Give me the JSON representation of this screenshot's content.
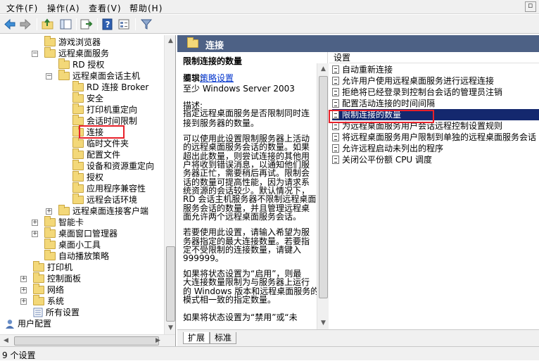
{
  "menu": {
    "file": "文件(F)",
    "action": "操作(A)",
    "view": "查看(V)",
    "help": "帮助(H)"
  },
  "tree": {
    "items": [
      {
        "label": "游戏浏览器",
        "depth": 4,
        "expander": ""
      },
      {
        "label": "远程桌面服务",
        "depth": 4,
        "expander": "−"
      },
      {
        "label": "RD 授权",
        "depth": 5,
        "expander": ""
      },
      {
        "label": "远程桌面会话主机",
        "depth": 5,
        "expander": "−"
      },
      {
        "label": "RD 连接 Broker",
        "depth": 6,
        "expander": ""
      },
      {
        "label": "安全",
        "depth": 6,
        "expander": ""
      },
      {
        "label": "打印机重定向",
        "depth": 6,
        "expander": ""
      },
      {
        "label": "会话时间限制",
        "depth": 6,
        "expander": ""
      },
      {
        "label": "连接",
        "depth": 6,
        "expander": ""
      },
      {
        "label": "临时文件夹",
        "depth": 6,
        "expander": ""
      },
      {
        "label": "配置文件",
        "depth": 6,
        "expander": ""
      },
      {
        "label": "设备和资源重定向",
        "depth": 6,
        "expander": ""
      },
      {
        "label": "授权",
        "depth": 6,
        "expander": ""
      },
      {
        "label": "应用程序兼容性",
        "depth": 6,
        "expander": ""
      },
      {
        "label": "远程会话环境",
        "depth": 6,
        "expander": ""
      },
      {
        "label": "远程桌面连接客户端",
        "depth": 5,
        "expander": "+"
      },
      {
        "label": "智能卡",
        "depth": 4,
        "expander": "+"
      },
      {
        "label": "桌面窗口管理器",
        "depth": 4,
        "expander": "+"
      },
      {
        "label": "桌面小工具",
        "depth": 4,
        "expander": ""
      },
      {
        "label": "自动播放策略",
        "depth": 4,
        "expander": ""
      },
      {
        "label": "打印机",
        "depth": 3,
        "expander": ""
      },
      {
        "label": "控制面板",
        "depth": 3,
        "expander": "+"
      },
      {
        "label": "网络",
        "depth": 3,
        "expander": "+"
      },
      {
        "label": "系统",
        "depth": 3,
        "expander": "+"
      },
      {
        "label": "所有设置",
        "depth": 3,
        "expander": ""
      },
      {
        "label": "用户配置",
        "depth": 1,
        "expander": "−"
      }
    ]
  },
  "panel": {
    "header": "连接",
    "desc_title": "限制连接的数量",
    "edit_prefix": "编辑",
    "edit_link": "策略设置",
    "desc_lines": [
      "要求:",
      "至少 Windows Server 2003",
      "描述:",
      "指定远程桌面服务是否限制同时连",
      "接到服务器的数量。",
      "可以使用此设置限制服务器上活动",
      "的远程桌面服务会话的数量。如果",
      "超出此数量，则尝试连接的其他用",
      "户将收到错误消息，以通知他们服",
      "务器正忙，需要稍后再试。限制会",
      "话的数量可提高性能，因为请求系",
      "统资源的会话较少。默认情况下，",
      "RD 会话主机服务器不限制远程桌面",
      "服务会话的数量，并且管理远程桌",
      "面允许两个远程桌面服务会话。",
      "若要使用此设置，请输入希望为服",
      "务器指定的最大连接数量。若要指",
      "定不受限制的连接数量，请键入",
      "999999。",
      "如果将状态设置为“启用”，则最",
      "大连接数量限制为与服务器上运行",
      "的 Windows 版本和远程桌面服务的",
      "模式相一致的指定数量。",
      "如果将状态设置为“禁用”或“未"
    ],
    "list_header": "设置",
    "settings": [
      "自动重新连接",
      "允许用户使用远程桌面服务进行远程连接",
      "拒绝将已经登录到控制台会话的管理员注销",
      "配置活动连接的时间间隔",
      "限制连接的数量",
      "为远程桌面服务用户会话远程控制设置规则",
      "将远程桌面服务用户限制到单独的远程桌面服务会话",
      "允许远程启动未列出的程序",
      "关闭公平份额 CPU 调度"
    ],
    "selected_index": 4,
    "tabs": [
      "扩展",
      "标准"
    ]
  },
  "status": "9 个设置"
}
